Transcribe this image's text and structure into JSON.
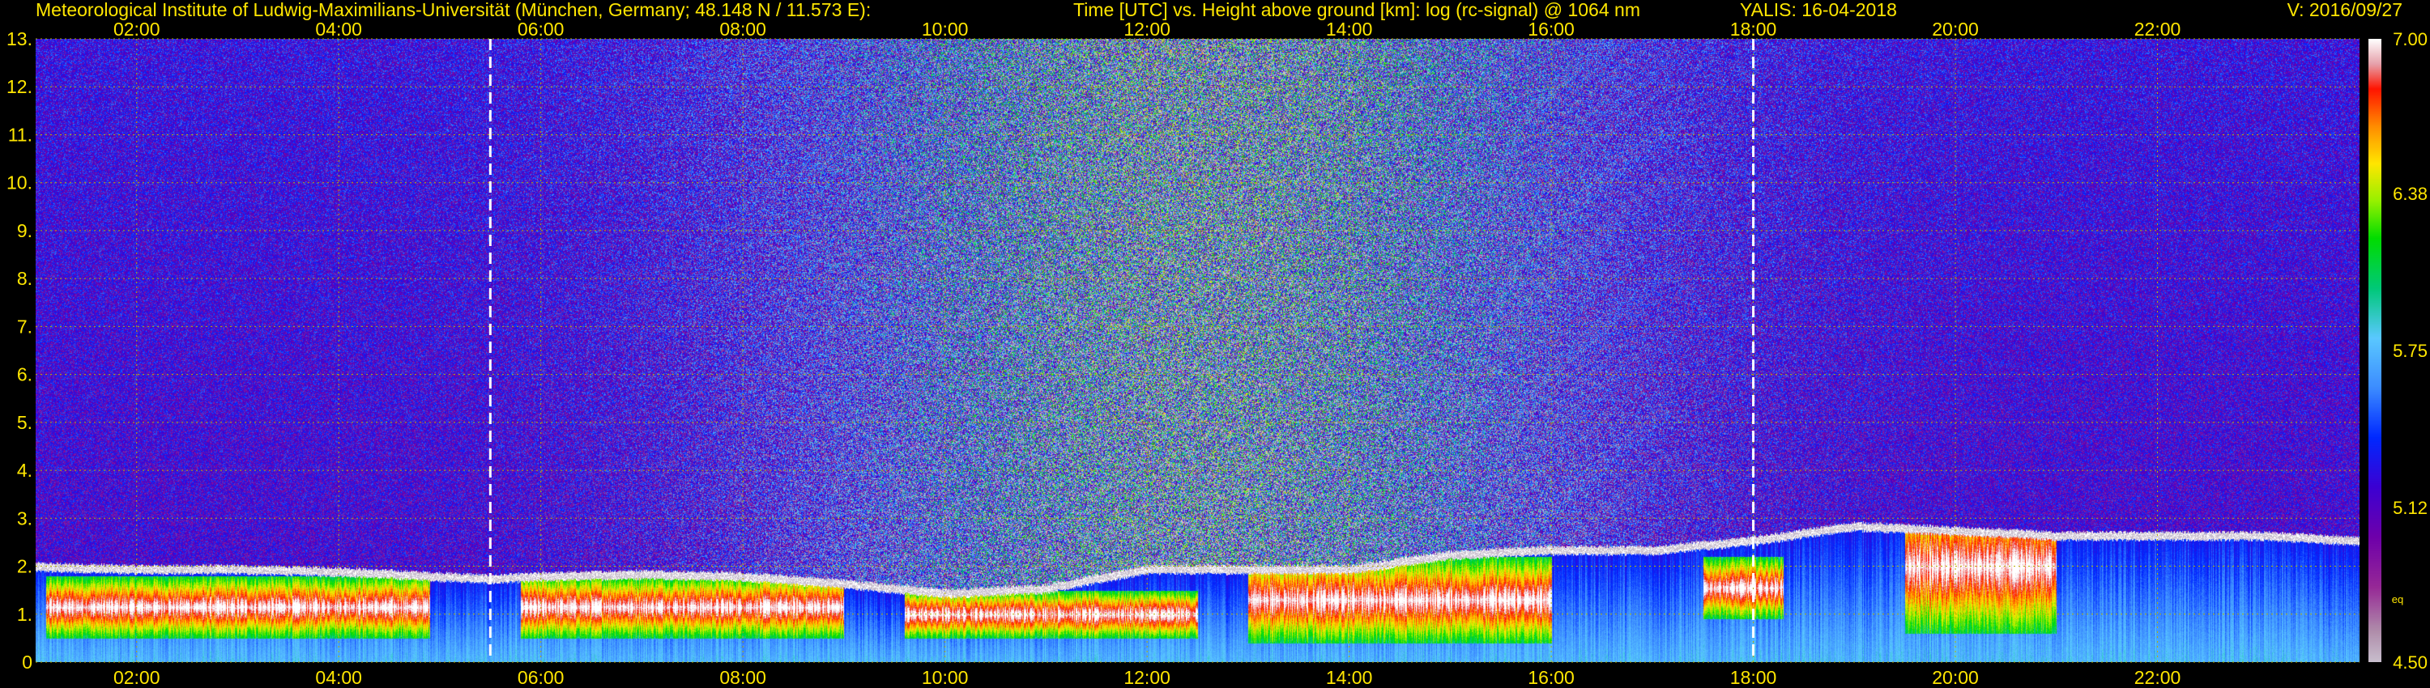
{
  "header": {
    "left": "Meteorological Institute of Ludwig-Maximilians-Universität (München, Germany; 48.148 N / 11.573 E):",
    "center": "Time [UTC] vs. Height above ground [km]: log (rc-signal) @ 1064 nm",
    "instrument": "YALIS: 16-04-2018",
    "version": "V: 2016/09/27"
  },
  "colors": {
    "header_text": "#ffe600",
    "axis_text": "#ffe600",
    "grid": "#b8b000",
    "background": "#000000",
    "marker": "#ffffff"
  },
  "chart_data": {
    "type": "heatmap",
    "xlim": [
      1.0,
      24.0
    ],
    "ylim": [
      0,
      13
    ],
    "x_ticks": [
      "02:00",
      "04:00",
      "06:00",
      "08:00",
      "10:00",
      "12:00",
      "14:00",
      "16:00",
      "18:00",
      "20:00",
      "22:00"
    ],
    "y_ticks": [
      "0",
      "1.",
      "2.",
      "3.",
      "4.",
      "5.",
      "6.",
      "7.",
      "8.",
      "9.",
      "10.",
      "11.",
      "12.",
      "13."
    ],
    "grid": true,
    "vertical_markers_utc": [
      5.5,
      18.0
    ],
    "colorbar": {
      "vmin": 4.5,
      "vmax": 7.0,
      "labels": [
        "7.00",
        "6.38",
        "5.75",
        "5.12",
        "4.50"
      ],
      "label_values": [
        7.0,
        6.38,
        5.75,
        5.12,
        4.5
      ],
      "footnote": "eq"
    },
    "boundary_layer_top_km": [
      [
        1.0,
        1.95
      ],
      [
        2.0,
        1.9
      ],
      [
        3.0,
        1.9
      ],
      [
        4.0,
        1.85
      ],
      [
        5.0,
        1.75
      ],
      [
        5.5,
        1.7
      ],
      [
        6.0,
        1.75
      ],
      [
        7.0,
        1.8
      ],
      [
        8.0,
        1.75
      ],
      [
        9.0,
        1.6
      ],
      [
        10.0,
        1.4
      ],
      [
        11.0,
        1.5
      ],
      [
        12.0,
        1.9
      ],
      [
        13.0,
        1.9
      ],
      [
        14.0,
        1.9
      ],
      [
        15.0,
        2.2
      ],
      [
        16.0,
        2.3
      ],
      [
        17.0,
        2.3
      ],
      [
        17.5,
        2.4
      ],
      [
        18.0,
        2.5
      ],
      [
        19.0,
        2.8
      ],
      [
        20.0,
        2.7
      ],
      [
        21.0,
        2.6
      ],
      [
        22.0,
        2.6
      ],
      [
        23.0,
        2.6
      ],
      [
        24.0,
        2.5
      ]
    ],
    "cloud_segments": [
      {
        "x": [
          1.1,
          4.9
        ],
        "base_km": 0.5,
        "top_km": 1.8
      },
      {
        "x": [
          5.8,
          9.0
        ],
        "base_km": 0.5,
        "top_km": 1.8
      },
      {
        "x": [
          9.6,
          12.5
        ],
        "base_km": 0.5,
        "top_km": 1.5
      },
      {
        "x": [
          13.0,
          16.0
        ],
        "base_km": 0.4,
        "top_km": 2.2
      },
      {
        "x": [
          17.5,
          18.3
        ],
        "base_km": 0.9,
        "top_km": 2.2
      },
      {
        "x": [
          19.5,
          21.0
        ],
        "base_km": 0.6,
        "top_km": 3.4
      }
    ]
  }
}
